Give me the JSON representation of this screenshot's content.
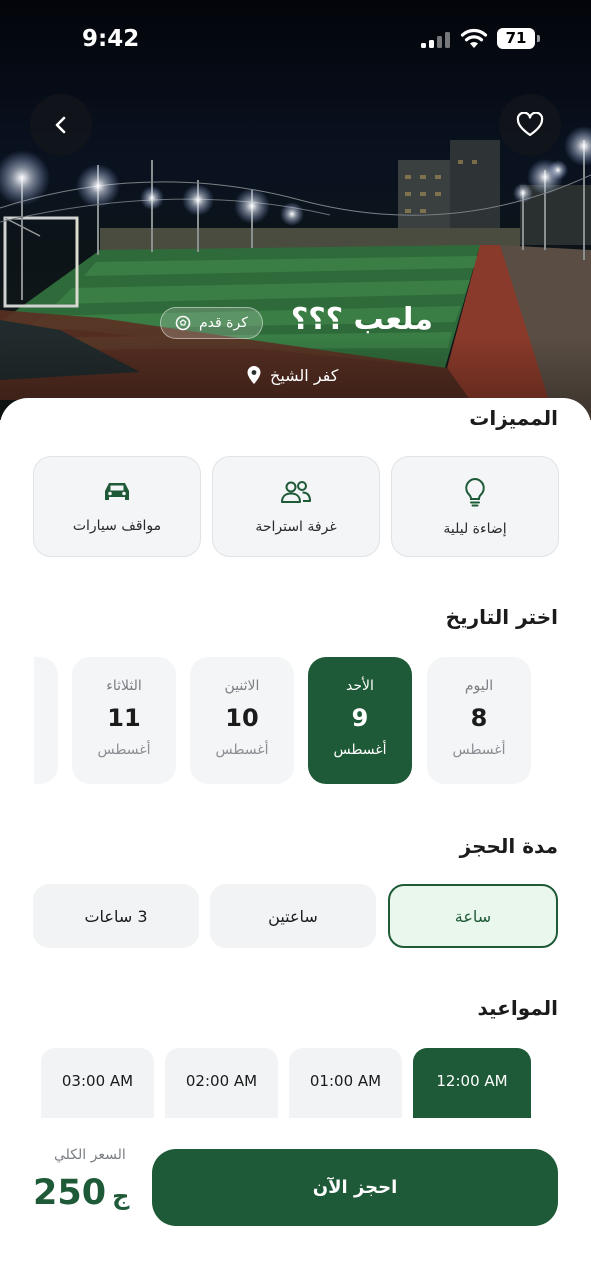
{
  "status_bar": {
    "time": "9:42",
    "battery": "71"
  },
  "venue": {
    "title": "ملعب ؟؟؟",
    "sport": "كرة قدم",
    "location": "كفر الشيخ"
  },
  "features": {
    "title": "المميزات",
    "items": [
      {
        "label": "إضاءة ليلية",
        "icon": "lightbulb-icon"
      },
      {
        "label": "غرفة استراحة",
        "icon": "people-icon"
      },
      {
        "label": "مواقف سيارات",
        "icon": "car-icon"
      }
    ]
  },
  "dates": {
    "title": "اختر التاريخ",
    "items": [
      {
        "day": "اليوم",
        "num": "8",
        "month": "أغسطس",
        "selected": false
      },
      {
        "day": "الأحد",
        "num": "9",
        "month": "أغسطس",
        "selected": true
      },
      {
        "day": "الاثنين",
        "num": "10",
        "month": "أغسطس",
        "selected": false
      },
      {
        "day": "الثلاثاء",
        "num": "11",
        "month": "أغسطس",
        "selected": false
      }
    ]
  },
  "duration": {
    "title": "مدة الحجز",
    "options": [
      {
        "label": "ساعة",
        "selected": true
      },
      {
        "label": "ساعتين",
        "selected": false
      },
      {
        "label": "3 ساعات",
        "selected": false
      }
    ]
  },
  "slots": {
    "title": "المواعيد",
    "items": [
      {
        "label": "12:00 AM",
        "selected": true
      },
      {
        "label": "01:00 AM",
        "selected": false
      },
      {
        "label": "02:00 AM",
        "selected": false
      },
      {
        "label": "03:00 AM",
        "selected": false
      }
    ]
  },
  "footer": {
    "price_label": "السعر الكلي",
    "price": "250",
    "currency": "ج",
    "book_label": "احجز الآن"
  },
  "colors": {
    "primary": "#1e5a37",
    "selected_light": "#eaf7ec",
    "card_bg": "#f3f5f6"
  }
}
